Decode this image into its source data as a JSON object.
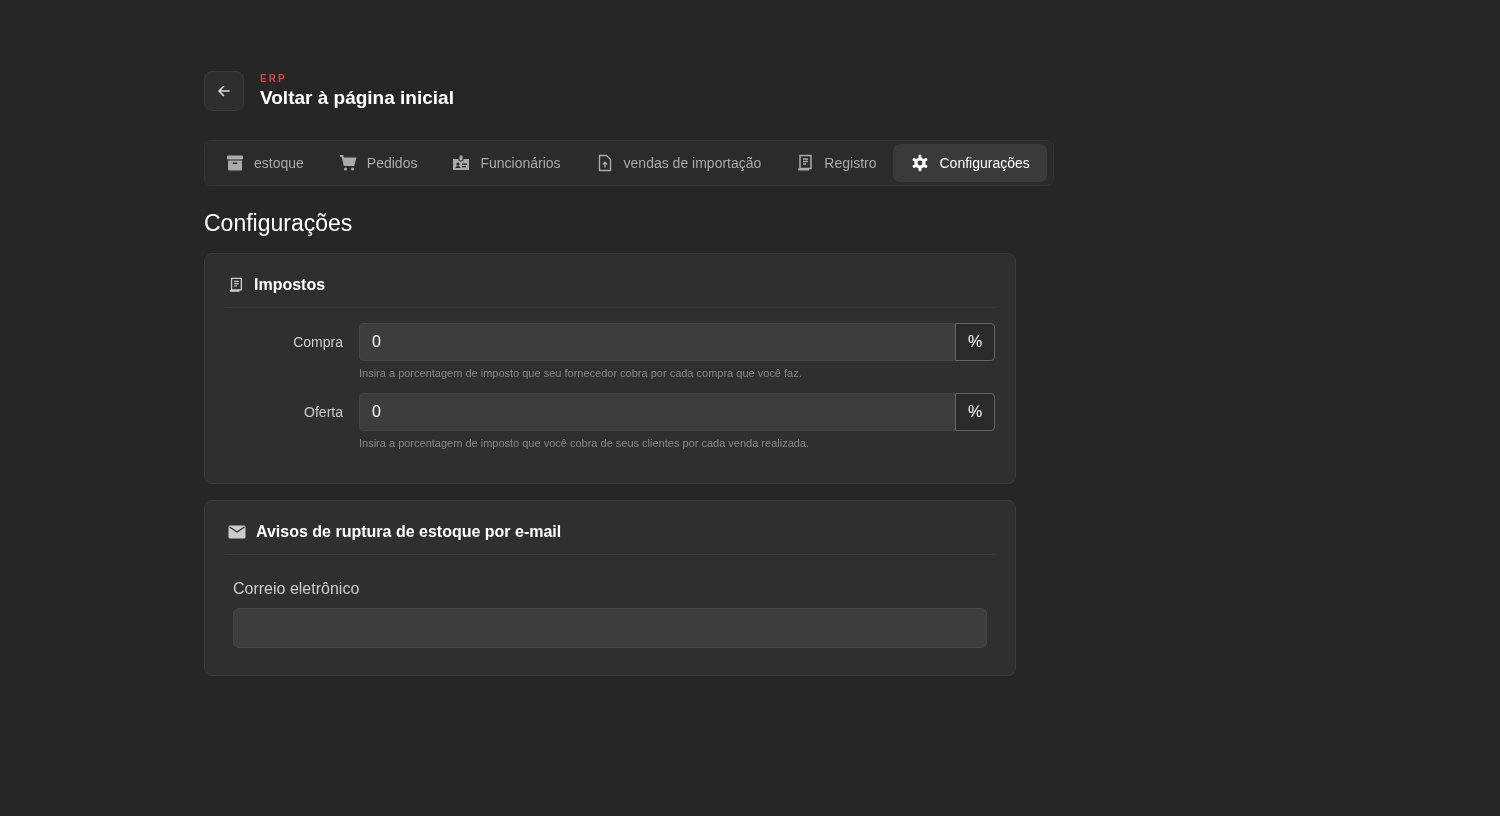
{
  "header": {
    "eyebrow": "ERP",
    "title": "Voltar à página inicial"
  },
  "tabs": [
    {
      "label": "estoque",
      "kind": "archive",
      "selected": false
    },
    {
      "label": "Pedidos",
      "kind": "cart",
      "selected": false
    },
    {
      "label": "Funcionários",
      "kind": "badge",
      "selected": false
    },
    {
      "label": "vendas de importação",
      "kind": "file",
      "selected": false
    },
    {
      "label": "Registro",
      "kind": "receipt",
      "selected": false
    },
    {
      "label": "Configurações",
      "kind": "gear",
      "selected": true
    }
  ],
  "page_title": "Configurações",
  "cards": [
    {
      "title": "Impostos",
      "kind": "taxes",
      "fields": [
        {
          "label": "Compra",
          "value": "0",
          "suffix": "%",
          "hint": "Insira a porcentagem de imposto que seu fornecedor cobra por cada compra que você faz."
        },
        {
          "label": "Oferta",
          "value": "0",
          "suffix": "%",
          "hint": "Insira a porcentagem de imposto que você cobra de seus clientes por cada venda realizada."
        }
      ]
    },
    {
      "title": "Avisos de ruptura de estoque por e-mail",
      "kind": "email",
      "fields": [
        {
          "label": "Correio eletrônico"
        }
      ]
    }
  ]
}
